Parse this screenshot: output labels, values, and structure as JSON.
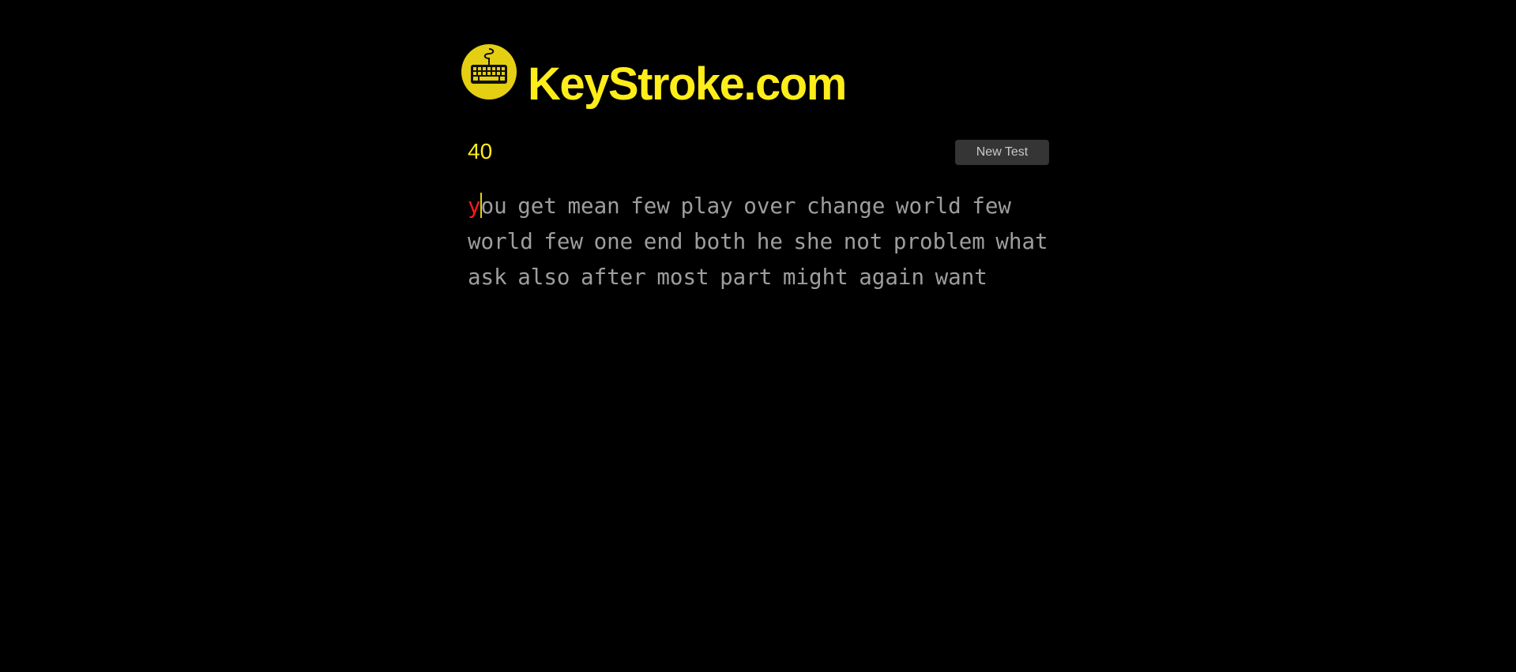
{
  "brand": {
    "title": "KeyStroke.com",
    "logo_icon": "keyboard-icon",
    "accent_color": "#ffed1a"
  },
  "timer": {
    "seconds": "40"
  },
  "actions": {
    "new_test_label": "New Test"
  },
  "test": {
    "first_word_typed": "y",
    "first_word_rest": "ou",
    "remaining_text": " get mean few play over change world few world few one end both he she not problem what ask also after most part might again want",
    "incorrect_color": "#ff1a1a",
    "untyped_color": "#9e9e9e"
  }
}
